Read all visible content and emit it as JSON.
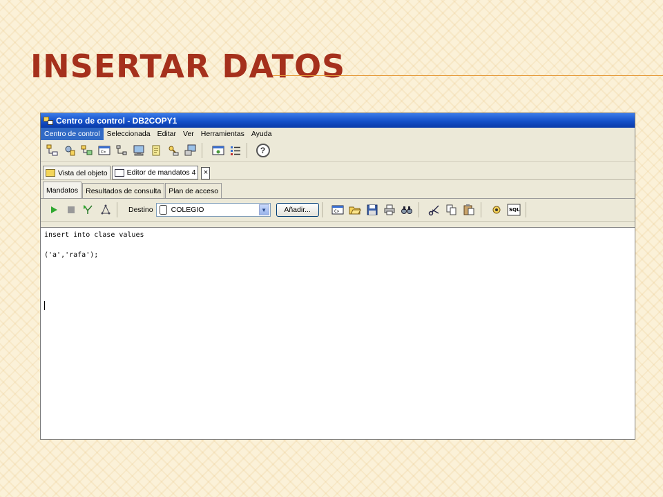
{
  "slide": {
    "title": "INSERTAR DATOS"
  },
  "window": {
    "title": "Centro de control - DB2COPY1"
  },
  "menu": {
    "items": [
      "Centro de control",
      "Seleccionada",
      "Editar",
      "Ver",
      "Herramientas",
      "Ayuda"
    ]
  },
  "doc_tabs": {
    "object_view": "Vista del objeto",
    "command_editor": "Editor de mandatos 4",
    "close": "×"
  },
  "sub_tabs": {
    "commands": "Mandatos",
    "query_results": "Resultados de consulta",
    "access_plan": "Plan de acceso"
  },
  "command_toolbar": {
    "target_label": "Destino",
    "target_value": "COLEGIO",
    "add_button": "Añadir...",
    "sql_badge": "SQL"
  },
  "editor": {
    "lines": [
      "insert into clase values",
      "('a','rafa');"
    ]
  },
  "colors": {
    "title": "#a5301c",
    "titlebar": "#1450c9",
    "menu_highlight": "#316ac5",
    "accent_rule": "#e59a3a"
  },
  "icons": {
    "toolbar": [
      "object-tree-icon",
      "tools-settings-icon",
      "systems-icon",
      "command-window-icon",
      "network-icon",
      "monitor-icon",
      "journal-icon",
      "license-icon",
      "computer-icon",
      "task-icon",
      "list-icon",
      "help-icon"
    ],
    "command_toolbar": [
      "run-icon",
      "stop-icon",
      "explain-icon",
      "access-plan-icon",
      "clear-icon",
      "open-icon",
      "save-icon",
      "print-icon",
      "find-icon",
      "cut-icon",
      "copy-icon",
      "paste-icon",
      "settings-icon",
      "sql-assist-icon"
    ]
  }
}
